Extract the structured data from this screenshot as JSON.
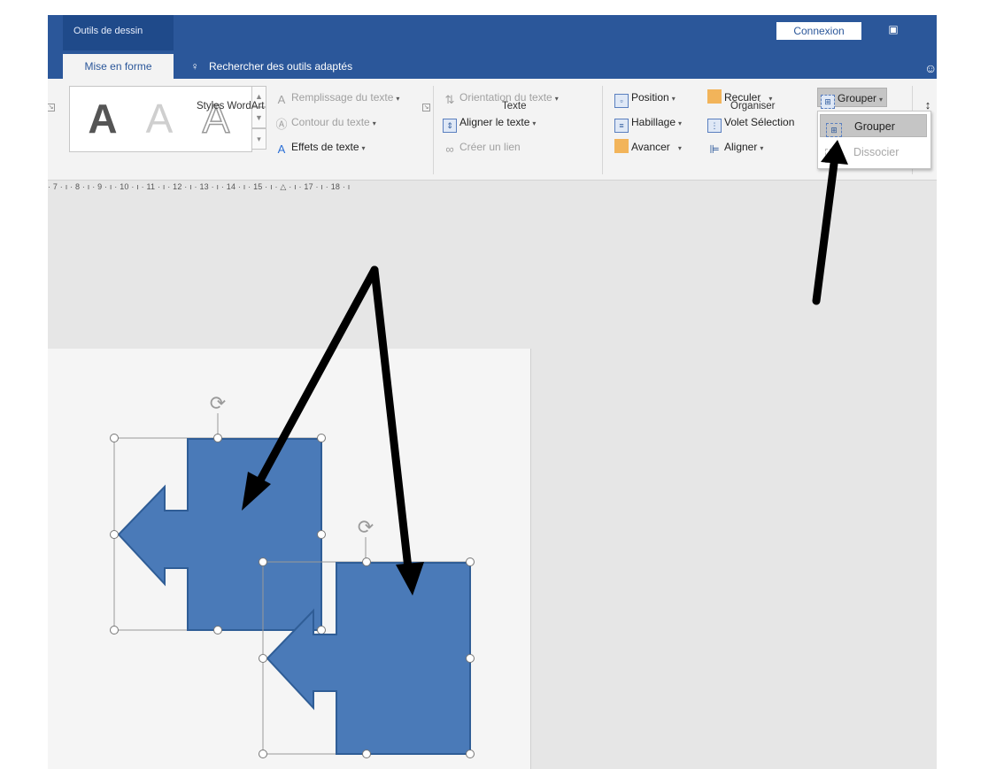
{
  "titlebar": {
    "context_tab_group": "Outils de dessin",
    "signin_label": "Connexion",
    "ribbon_display_icon": "ribbon-display-options-icon",
    "user_icon": "user-icon"
  },
  "tabs": {
    "active_tab": "Mise en forme",
    "tell_me": "Rechercher des outils adaptés"
  },
  "wordart": {
    "samples": [
      "A",
      "A",
      "A"
    ],
    "fill": "Remplissage du texte",
    "outline": "Contour du texte",
    "effects": "Effets de texte",
    "group_label": "Styles WordArt"
  },
  "text_group": {
    "direction": "Orientation du texte",
    "align": "Aligner le texte",
    "link": "Créer un lien",
    "group_label": "Texte"
  },
  "arrange": {
    "position": "Position",
    "wrap": "Habillage",
    "forward": "Avancer",
    "backward": "Reculer",
    "selection_pane": "Volet Sélection",
    "align": "Aligner",
    "group": "Grouper",
    "group_label": "Organiser"
  },
  "group_menu": {
    "items": [
      {
        "label": "Grouper",
        "enabled": true
      },
      {
        "label": "Dissocier",
        "enabled": false
      }
    ]
  },
  "ruler": {
    "text": "· 7 · ı · 8 · ı · 9 · ı · 10 · ı · 11 · ı · 12 · ı · 13 · ı · 14 · ı · 15 · ı · △ · ı · 17 · ı · 18 · ı"
  },
  "colors": {
    "titlebar": "#2b579a",
    "shape_fill": "#4a7ab8",
    "shape_stroke": "#2f5d96",
    "annotation_arrow": "#000000"
  }
}
